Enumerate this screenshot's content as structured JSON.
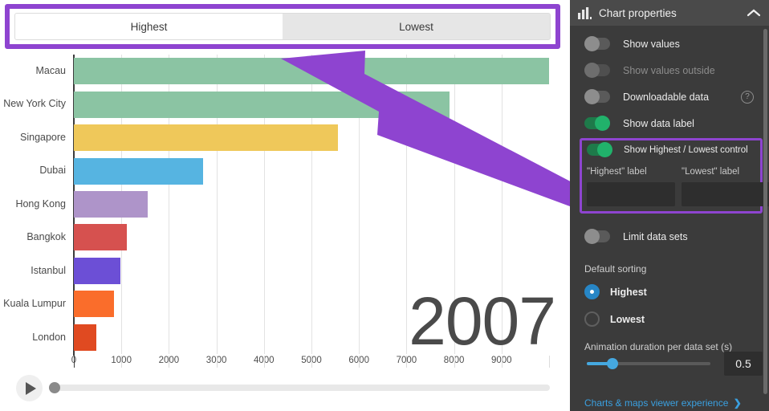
{
  "highest_lowest_control": {
    "tabs": [
      {
        "label": "Highest",
        "active": true
      },
      {
        "label": "Lowest",
        "active": false
      }
    ]
  },
  "chart_data": {
    "type": "bar",
    "orientation": "horizontal",
    "title": "",
    "year_label": "2007",
    "xlabel": "",
    "ylabel": "",
    "xlim": [
      0,
      10000
    ],
    "grid": true,
    "legend": "none",
    "xticks": [
      0,
      1000,
      2000,
      3000,
      4000,
      5000,
      6000,
      7000,
      8000,
      9000
    ],
    "categories": [
      "Macau",
      "New York City",
      "Singapore",
      "Dubai",
      "Hong Kong",
      "Bangkok",
      "Istanbul",
      "Kuala Lumpur",
      "London"
    ],
    "values": [
      10050,
      7900,
      5560,
      2720,
      1560,
      1110,
      985,
      845,
      475
    ],
    "colors": [
      "#8BC4A3",
      "#8BC4A3",
      "#EFC85A",
      "#56B4E1",
      "#AE94C9",
      "#D6514F",
      "#6C4FD6",
      "#FA6D2B",
      "#E04A21"
    ]
  },
  "playback": {
    "play_icon": "play-icon",
    "position_percent": 0
  },
  "panel": {
    "icon": "bar-chart-icon",
    "title": "Chart properties",
    "collapse_icon": "chevron-up-icon",
    "toggles": [
      {
        "label": "Show values",
        "on": false,
        "disabled": false,
        "help": false
      },
      {
        "label": "Show values outside",
        "on": false,
        "disabled": true,
        "help": false
      },
      {
        "label": "Downloadable data",
        "on": false,
        "disabled": false,
        "help": true,
        "help_icon": "question-mark-icon",
        "help_glyph": "?"
      },
      {
        "label": "Show data label",
        "on": true,
        "disabled": false,
        "help": false
      }
    ],
    "highlighted_group": {
      "toggle_label": "Show Highest / Lowest control",
      "toggle_on": true,
      "highest_field": {
        "label": "\"Highest\" label",
        "value": "",
        "placeholder": ""
      },
      "lowest_field": {
        "label": "\"Lowest\" label",
        "value": "",
        "placeholder": ""
      }
    },
    "limit_data_sets": {
      "label": "Limit data sets",
      "on": false
    },
    "default_sorting": {
      "label": "Default sorting",
      "options": [
        {
          "label": "Highest",
          "checked": true
        },
        {
          "label": "Lowest",
          "checked": false
        }
      ]
    },
    "animation": {
      "label": "Animation duration per data set (s)",
      "value": "0.5",
      "slider_percent": 21
    },
    "viewer_link": {
      "label": "Charts & maps viewer experience",
      "chevron": "❯"
    }
  },
  "annotation": {
    "accent_color": "#8e44d0",
    "arrow": "arrow-pointing-to-highest-lowest-tabs"
  }
}
